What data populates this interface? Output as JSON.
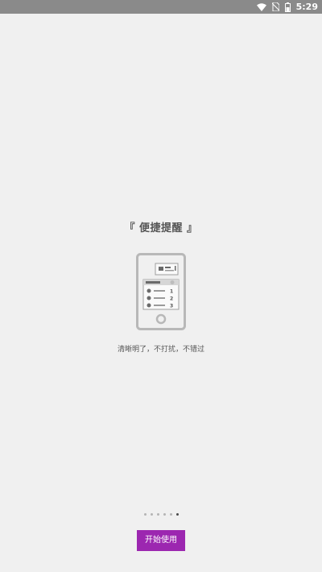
{
  "status_bar": {
    "time": "5:29",
    "icons": [
      "wifi-icon",
      "no-sim-icon",
      "battery-icon"
    ]
  },
  "onboarding": {
    "title": "『 便捷提醒 』",
    "subtitle": "清晰明了，不打扰，不错过",
    "illustration_numbers": [
      "1",
      "2",
      "3"
    ],
    "pagination": {
      "total": 6,
      "current": 6
    },
    "start_button_label": "开始使用"
  },
  "colors": {
    "status_bar": "#8a8a8a",
    "background": "#f0f0f0",
    "accent": "#9c27b0",
    "text": "#555555"
  }
}
